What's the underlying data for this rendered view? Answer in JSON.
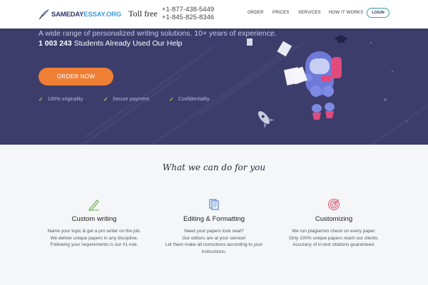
{
  "header": {
    "logo_part1": "SAMEDAY",
    "logo_part2": "ESSAY.ORG",
    "toll_free_label": "Toll free",
    "phone1": "+1-877-438-5449",
    "phone2": "+1-845-825-8346",
    "nav": [
      "ORDER",
      "PRICES",
      "SERVICES",
      "HOW IT WORKS"
    ],
    "login_label": "LOGIN"
  },
  "hero": {
    "subtitle": "A wide range of personalized writing solutions. 10+ years of experience.",
    "count": "1 003 243",
    "count_suffix": "Students Already Used Our Help",
    "order_button": "ORDER NOW",
    "features": [
      "100% originality.",
      "Secure payment.",
      "Confidentiality."
    ]
  },
  "services_section": {
    "title": "What we can do for you",
    "items": [
      {
        "icon": "pencil-ruler-icon",
        "title": "Custom writing",
        "lines": [
          "Name your topic & get a pro writer on the job.",
          "We deliver unique papers in any discipline.",
          "Following your requirements is our #1 rule."
        ]
      },
      {
        "icon": "documents-icon",
        "title": "Editing & Formatting",
        "lines": [
          "Need your papers look neat?",
          "Our editors are at your service!",
          "Let them make all corrections according to your",
          "instructions."
        ]
      },
      {
        "icon": "target-icon",
        "title": "Customizing",
        "lines": [
          "We run plagiarism check on every paper.",
          "Only 100% unique papers reach our clients.",
          "Accuracy of in-text citations guaranteed."
        ]
      }
    ]
  },
  "colors": {
    "hero_bg": "#3c3d6b",
    "accent_orange": "#f07f36",
    "brand_navy": "#2d3366",
    "brand_blue": "#3b9bd6",
    "check_green": "#a8d44a"
  }
}
